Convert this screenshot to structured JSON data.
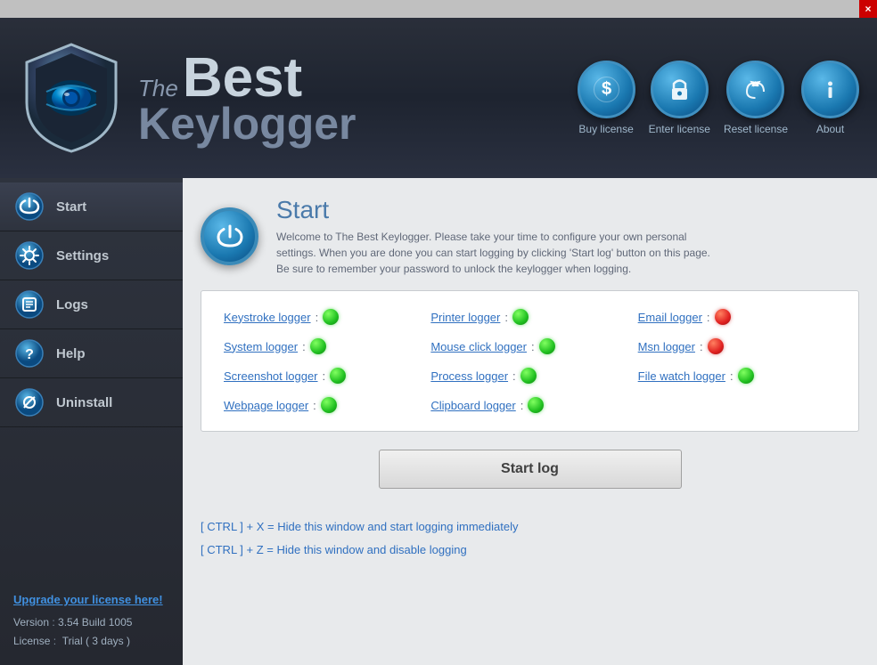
{
  "window": {
    "close_btn": "×"
  },
  "header": {
    "title_the": "The",
    "title_best": "Best",
    "title_keylogger": "Keylogger",
    "buttons": [
      {
        "id": "buy-license",
        "label": "Buy license",
        "icon": "dollar"
      },
      {
        "id": "enter-license",
        "label": "Enter license",
        "icon": "lock"
      },
      {
        "id": "reset-license",
        "label": "Reset license",
        "icon": "recycle"
      },
      {
        "id": "about",
        "label": "About",
        "icon": "info"
      }
    ]
  },
  "sidebar": {
    "nav_items": [
      {
        "id": "start",
        "label": "Start",
        "icon": "power"
      },
      {
        "id": "settings",
        "label": "Settings",
        "icon": "settings"
      },
      {
        "id": "logs",
        "label": "Logs",
        "icon": "logs"
      },
      {
        "id": "help",
        "label": "Help",
        "icon": "help"
      },
      {
        "id": "uninstall",
        "label": "Uninstall",
        "icon": "uninstall"
      }
    ],
    "upgrade_link": "Upgrade your license here!",
    "version_label": "Version",
    "version_value": "3.54 Build 1005",
    "license_label": "License",
    "license_value": "Trial ( 3 days )"
  },
  "content": {
    "page_title": "Start",
    "page_desc": "Welcome to The Best Keylogger. Please take your time to configure your own personal settings. When you are done you can start logging by clicking 'Start log' button on this page. Be sure to remember your password to unlock the keylogger when logging.",
    "loggers": [
      {
        "label": "Keystroke logger",
        "status": "green",
        "col": 0
      },
      {
        "label": "Printer logger",
        "status": "green",
        "col": 1
      },
      {
        "label": "Email logger",
        "status": "red",
        "col": 2
      },
      {
        "label": "System logger",
        "status": "green",
        "col": 0
      },
      {
        "label": "Mouse click logger",
        "status": "green",
        "col": 1
      },
      {
        "label": "Msn logger",
        "status": "red",
        "col": 2
      },
      {
        "label": "Screenshot logger",
        "status": "green",
        "col": 0
      },
      {
        "label": "Process logger",
        "status": "green",
        "col": 1
      },
      {
        "label": "File watch logger",
        "status": "green",
        "col": 2
      },
      {
        "label": "Webpage logger",
        "status": "green",
        "col": 0
      },
      {
        "label": "Clipboard logger",
        "status": "green",
        "col": 1
      }
    ],
    "start_log_btn": "Start log",
    "shortcut1": "[ CTRL ] + X = Hide this window and start logging immediately",
    "shortcut2": "[ CTRL ] + Z = Hide this window and disable logging"
  }
}
